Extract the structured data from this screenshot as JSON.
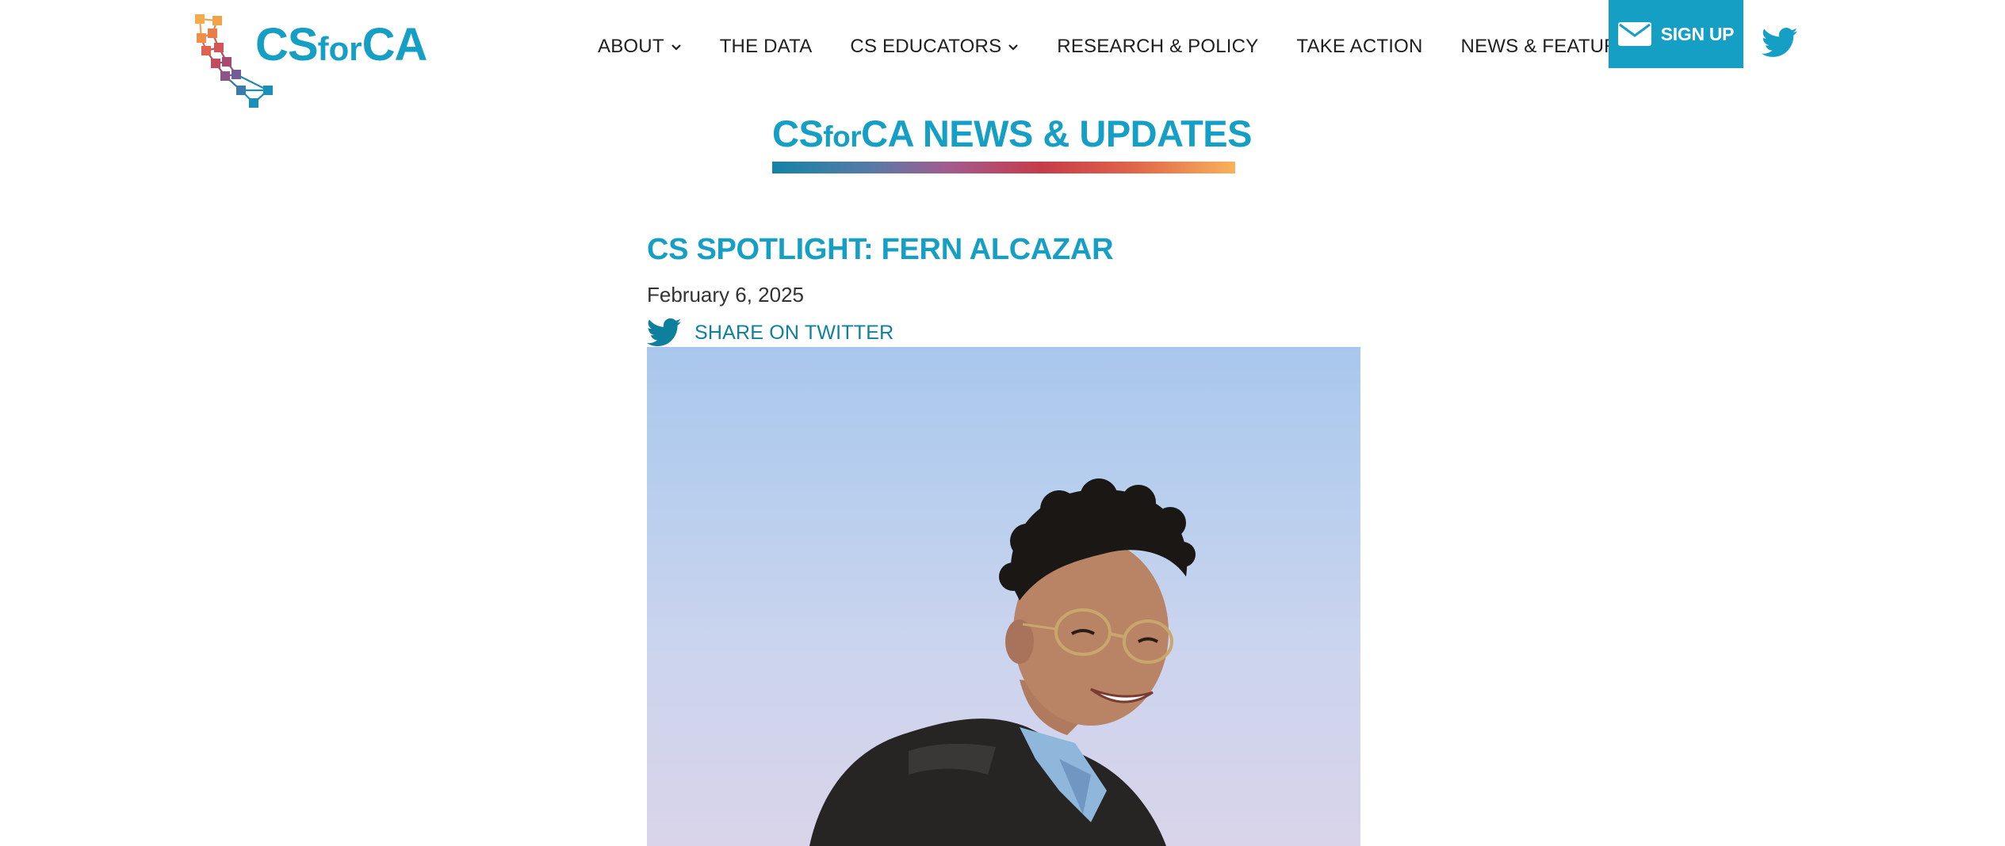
{
  "logo": {
    "brand_main": "CS",
    "brand_for": "for",
    "brand_end": "CA"
  },
  "nav": {
    "items": [
      {
        "label": "ABOUT",
        "has_dropdown": true
      },
      {
        "label": "THE DATA",
        "has_dropdown": false
      },
      {
        "label": "CS EDUCATORS",
        "has_dropdown": true
      },
      {
        "label": "RESEARCH & POLICY",
        "has_dropdown": false
      },
      {
        "label": "TAKE ACTION",
        "has_dropdown": false
      },
      {
        "label": "NEWS & FEATURES",
        "has_dropdown": true
      }
    ],
    "signup_label": "SIGN UP"
  },
  "page": {
    "title_brand_cs": "CS",
    "title_brand_for": "for",
    "title_brand_ca": "CA",
    "title_rest": " NEWS & UPDATES"
  },
  "article": {
    "title": "CS SPOTLIGHT: FERN ALCAZAR",
    "date": "February 6, 2025",
    "share_label": "SHARE ON TWITTER"
  },
  "colors": {
    "brand_blue": "#169fc5",
    "text_dark": "#1f1f1f",
    "share_blue": "#0f7f9e"
  },
  "icons": {
    "logo": "california-network-logo-icon",
    "chevron": "chevron-down-icon",
    "signup": "envelope-icon",
    "social": "twitter-bird-icon"
  }
}
